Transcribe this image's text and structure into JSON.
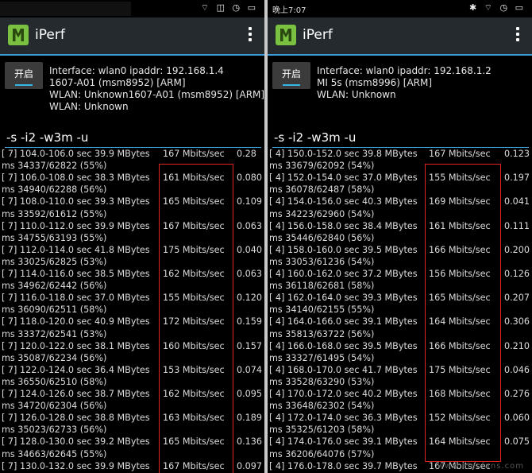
{
  "left": {
    "status": {
      "time": "",
      "icons": "⌔ ◫ ◷ ▭"
    },
    "app": {
      "title": "iPerf",
      "start_label": "开启"
    },
    "info": [
      "Interface: wlan0 ipaddr: 192.168.1.4",
      "1607-A01 (msm8952) [ARM]",
      "WLAN: Unknown1607-A01 (msm8952) [ARM]",
      "WLAN: Unknown"
    ],
    "cmd": "-s -i2 -w3m -u",
    "log_rows": [
      {
        "a": "[ 7] 104.0-106.0 sec 39.9 MBytes",
        "rate": "167 Mbits/sec",
        "tail": "0.28"
      },
      {
        "a": "ms 34337/62822 (55%)",
        "rate": "",
        "tail": ""
      },
      {
        "a": "[ 7] 106.0-108.0 sec 38.3 MBytes",
        "rate": "161 Mbits/sec",
        "tail": "0.080"
      },
      {
        "a": "ms 34940/62288 (56%)",
        "rate": "",
        "tail": ""
      },
      {
        "a": "[ 7] 108.0-110.0 sec 39.3 MBytes",
        "rate": "165 Mbits/sec",
        "tail": "0.109"
      },
      {
        "a": "ms 33592/61612 (55%)",
        "rate": "",
        "tail": ""
      },
      {
        "a": "[ 7] 110.0-112.0 sec 39.9 MBytes",
        "rate": "167 Mbits/sec",
        "tail": "0.063"
      },
      {
        "a": "ms 34755/63193 (55%)",
        "rate": "",
        "tail": ""
      },
      {
        "a": "[ 7] 112.0-114.0 sec 41.8 MBytes",
        "rate": "175 Mbits/sec",
        "tail": "0.040"
      },
      {
        "a": "ms 33025/62825 (53%)",
        "rate": "",
        "tail": ""
      },
      {
        "a": "[ 7] 114.0-116.0 sec 38.5 MBytes",
        "rate": "162 Mbits/sec",
        "tail": "0.063"
      },
      {
        "a": "ms 34962/62442 (56%)",
        "rate": "",
        "tail": ""
      },
      {
        "a": "[ 7] 116.0-118.0 sec 37.0 MBytes",
        "rate": "155 Mbits/sec",
        "tail": "0.120"
      },
      {
        "a": "ms 36090/62511 (58%)",
        "rate": "",
        "tail": ""
      },
      {
        "a": "[ 7] 118.0-120.0 sec 40.9 MBytes",
        "rate": "172 Mbits/sec",
        "tail": "0.159"
      },
      {
        "a": "ms 33372/62541 (53%)",
        "rate": "",
        "tail": ""
      },
      {
        "a": "[ 7] 120.0-122.0 sec 38.1 MBytes",
        "rate": "160 Mbits/sec",
        "tail": "0.157"
      },
      {
        "a": "ms 35087/62234 (56%)",
        "rate": "",
        "tail": ""
      },
      {
        "a": "[ 7] 122.0-124.0 sec 36.4 MBytes",
        "rate": "153 Mbits/sec",
        "tail": "0.074"
      },
      {
        "a": "ms 36550/62510 (58%)",
        "rate": "",
        "tail": ""
      },
      {
        "a": "[ 7] 124.0-126.0 sec 38.7 MBytes",
        "rate": "162 Mbits/sec",
        "tail": "0.095"
      },
      {
        "a": "ms 34720/62304 (56%)",
        "rate": "",
        "tail": ""
      },
      {
        "a": "[ 7] 126.0-128.0 sec 38.8 MBytes",
        "rate": "163 Mbits/sec",
        "tail": "0.189"
      },
      {
        "a": "ms 35023/62733 (56%)",
        "rate": "",
        "tail": ""
      },
      {
        "a": "[ 7] 128.0-130.0 sec 39.2 MBytes",
        "rate": "165 Mbits/sec",
        "tail": "0.136"
      },
      {
        "a": "ms 34663/62645 (55%)",
        "rate": "",
        "tail": ""
      },
      {
        "a": "[ 7] 130.0-132.0 sec 39.9 MBytes",
        "rate": "167 Mbits/sec",
        "tail": "0.097"
      }
    ]
  },
  "right": {
    "status": {
      "time": "晚上7:07",
      "icons": "✱ ⌔ ◷ ▭"
    },
    "app": {
      "title": "iPerf",
      "start_label": "开启"
    },
    "info": [
      "Interface: wlan0 ipaddr: 192.168.1.2",
      "MI 5s (msm8996) [ARM]",
      "WLAN: Unknown"
    ],
    "cmd": "-s -i2 -w3m -u",
    "log_rows": [
      {
        "a": "[ 4] 150.0-152.0 sec 39.8 MBytes",
        "rate": "167 Mbits/sec",
        "tail": "0.123"
      },
      {
        "a": "ms 33679/62092 (54%)",
        "rate": "",
        "tail": ""
      },
      {
        "a": "[ 4] 152.0-154.0 sec 37.0 MBytes",
        "rate": "155 Mbits/sec",
        "tail": "0.197"
      },
      {
        "a": "ms 36078/62487 (58%)",
        "rate": "",
        "tail": ""
      },
      {
        "a": "[ 4] 154.0-156.0 sec 40.3 MBytes",
        "rate": "169 Mbits/sec",
        "tail": "0.041"
      },
      {
        "a": "ms 34223/62960 (54%)",
        "rate": "",
        "tail": ""
      },
      {
        "a": "[ 4] 156.0-158.0 sec 38.4 MBytes",
        "rate": "161 Mbits/sec",
        "tail": "0.111"
      },
      {
        "a": "ms 35446/62840 (56%)",
        "rate": "",
        "tail": ""
      },
      {
        "a": "[ 4] 158.0-160.0 sec 39.5 MBytes",
        "rate": "166 Mbits/sec",
        "tail": "0.200"
      },
      {
        "a": "ms 33053/61236 (54%)",
        "rate": "",
        "tail": ""
      },
      {
        "a": "[ 4] 160.0-162.0 sec 37.2 MBytes",
        "rate": "156 Mbits/sec",
        "tail": "0.126"
      },
      {
        "a": "ms 36118/62681 (58%)",
        "rate": "",
        "tail": ""
      },
      {
        "a": "[ 4] 162.0-164.0 sec 39.3 MBytes",
        "rate": "165 Mbits/sec",
        "tail": "0.207"
      },
      {
        "a": "ms 34140/62155 (55%)",
        "rate": "",
        "tail": ""
      },
      {
        "a": "[ 4] 164.0-166.0 sec 39.1 MBytes",
        "rate": "164 Mbits/sec",
        "tail": "0.306"
      },
      {
        "a": "ms 35813/63722 (56%)",
        "rate": "",
        "tail": ""
      },
      {
        "a": "[ 4] 166.0-168.0 sec 39.5 MBytes",
        "rate": "166 Mbits/sec",
        "tail": "0.210"
      },
      {
        "a": "ms 33327/61495 (54%)",
        "rate": "",
        "tail": ""
      },
      {
        "a": "[ 4] 168.0-170.0 sec 41.7 MBytes",
        "rate": "175 Mbits/sec",
        "tail": "0.046"
      },
      {
        "a": "ms 33528/63290 (53%)",
        "rate": "",
        "tail": ""
      },
      {
        "a": "[ 4] 170.0-172.0 sec 40.2 MBytes",
        "rate": "168 Mbits/sec",
        "tail": "0.276"
      },
      {
        "a": "ms 33648/62302 (54%)",
        "rate": "",
        "tail": ""
      },
      {
        "a": "[ 4] 172.0-174.0 sec 36.3 MBytes",
        "rate": "152 Mbits/sec",
        "tail": "0.060"
      },
      {
        "a": "ms 35325/61203 (58%)",
        "rate": "",
        "tail": ""
      },
      {
        "a": "[ 4] 174.0-176.0 sec 39.1 MBytes",
        "rate": "164 Mbits/sec",
        "tail": "0.075"
      },
      {
        "a": "ms 36206/64076 (57%)",
        "rate": "",
        "tail": ""
      },
      {
        "a": "[ 4] 176.0-178.0 sec 39.7 MBytes",
        "rate": "167 Mbits/sec",
        "tail": ""
      }
    ],
    "watermark": "www.elecfans.com"
  },
  "colors": {
    "accent": "#3a9bd9",
    "highlight": "#dd2222",
    "logo": "#7ac142"
  }
}
